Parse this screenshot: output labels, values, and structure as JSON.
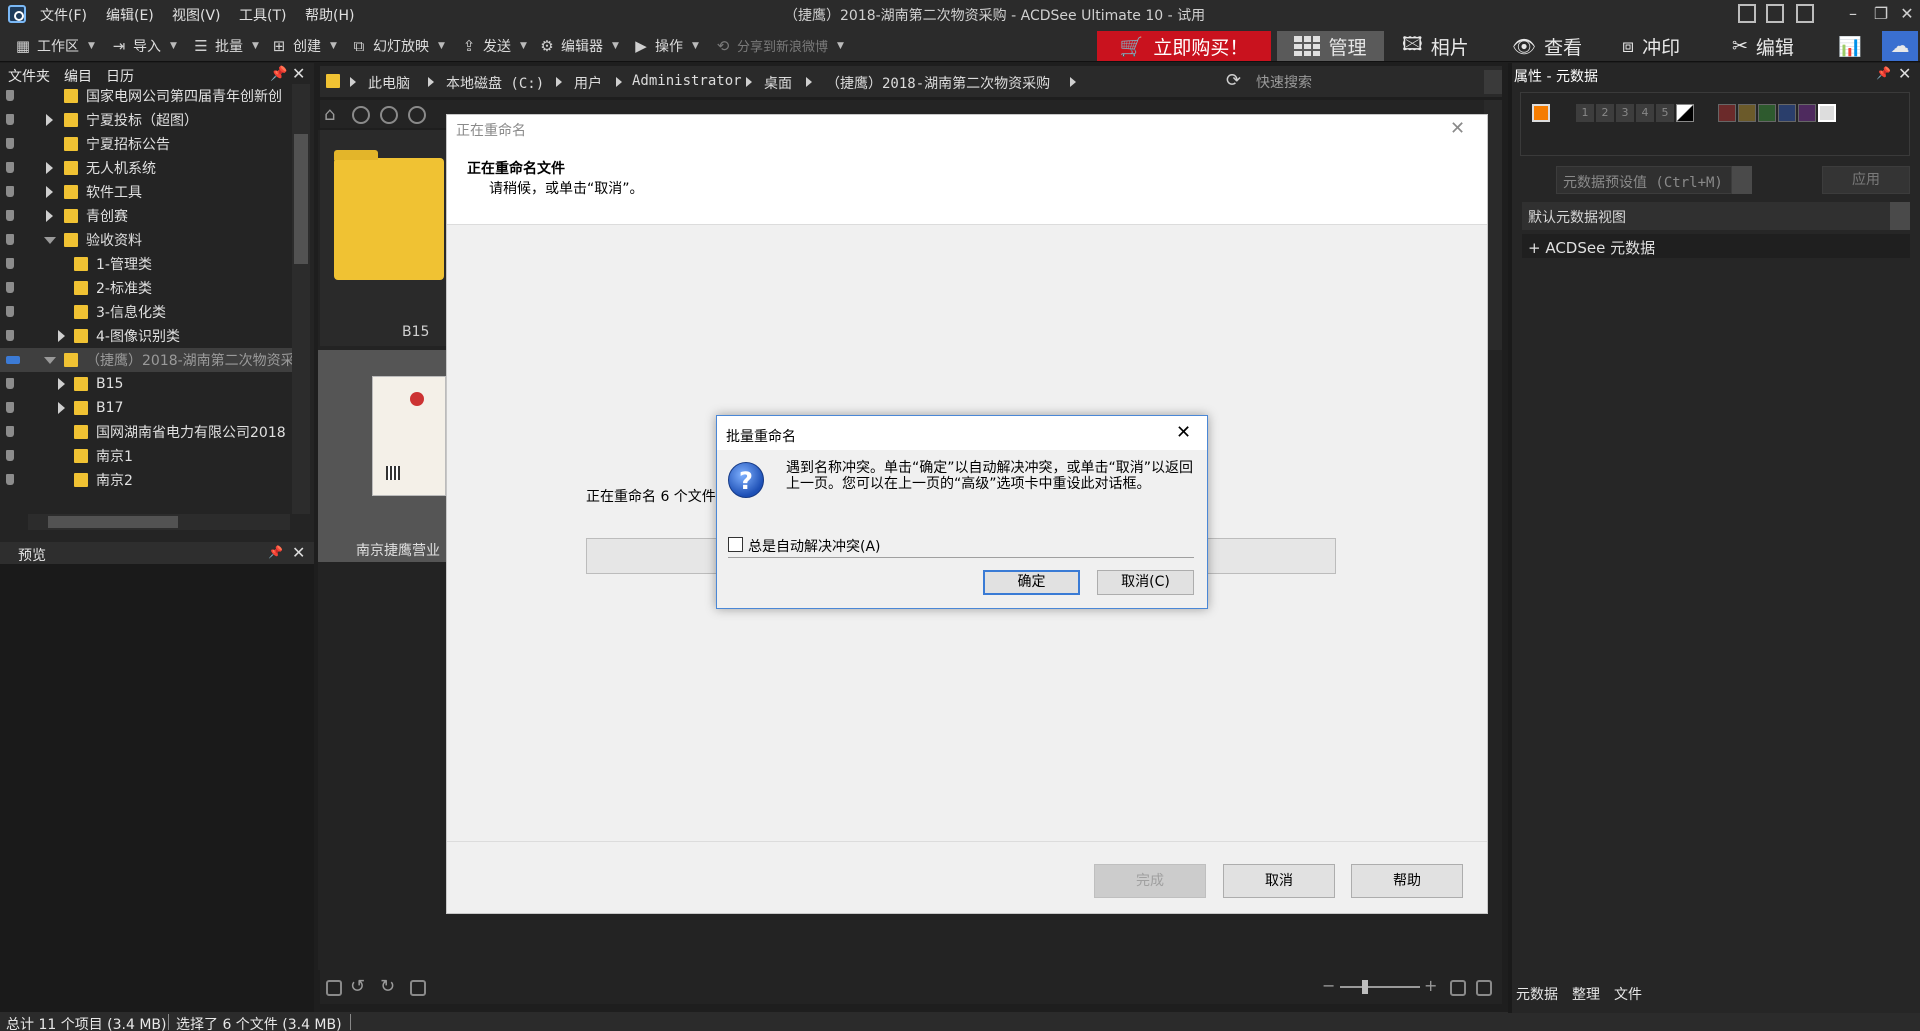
{
  "window": {
    "title": "（捷鹰）2018-湖南第二次物资采购 - ACDSee Ultimate 10 - 试用",
    "menu": [
      "文件(F)",
      "编辑(E)",
      "视图(V)",
      "工具(T)",
      "帮助(H)"
    ]
  },
  "toolbar": {
    "items": [
      "工作区",
      "导入",
      "批量",
      "创建",
      "幻灯放映",
      "发送",
      "编辑器",
      "操作",
      "分享到新浪微博"
    ],
    "buy_label": "立即购买！",
    "modes": [
      "管理",
      "相片",
      "查看",
      "冲印",
      "编辑"
    ]
  },
  "left_panel": {
    "tabs": [
      "文件夹",
      "编目",
      "日历"
    ],
    "tree": [
      {
        "label": "国家电网公司第四届青年创新创"
      },
      {
        "label": "宁夏投标（超图）"
      },
      {
        "label": "宁夏招标公告"
      },
      {
        "label": "无人机系统"
      },
      {
        "label": "软件工具"
      },
      {
        "label": "青创赛"
      },
      {
        "label": "验收资料"
      },
      {
        "label": "1-管理类"
      },
      {
        "label": "2-标准类"
      },
      {
        "label": "3-信息化类"
      },
      {
        "label": "4-图像识别类"
      },
      {
        "label": "（捷鹰）2018-湖南第二次物资采"
      },
      {
        "label": "B15"
      },
      {
        "label": "B17"
      },
      {
        "label": "国网湖南省电力有限公司2018"
      },
      {
        "label": "南京1"
      },
      {
        "label": "南京2"
      }
    ],
    "preview_label": "预览"
  },
  "address_bar": {
    "crumbs": [
      "此电脑",
      "本地磁盘 (C:)",
      "用户",
      "Administrator",
      "桌面",
      "（捷鹰）2018-湖南第二次物资采购"
    ],
    "search_placeholder": "快速搜索"
  },
  "browser": {
    "thumb_folder_label": "B15",
    "thumb_doc_label": "南京捷鹰营业"
  },
  "status": {
    "total": "总计 11 个项目 (3.4 MB)",
    "selected": "选择了 6 个文件 (3.4 MB)"
  },
  "right_panel": {
    "header": "属性 - 元数据",
    "ratings": [
      "1",
      "2",
      "3",
      "4",
      "5"
    ],
    "preset_placeholder": "元数据预设值 (Ctrl+M)",
    "apply_label": "应用",
    "view_label": "默认元数据视图",
    "acdsee_meta_label": "+ ACDSee 元数据",
    "bottom_tabs": [
      "元数据",
      "整理",
      "文件"
    ]
  },
  "rename_dialog": {
    "title": "正在重命名",
    "heading": "正在重命名文件",
    "subtext": "请稍候，或单击“取消”。",
    "progress_text": "正在重命名 6 个文件",
    "finish_label": "完成",
    "cancel_label": "取消",
    "help_label": "帮助"
  },
  "conflict_dialog": {
    "title": "批量重命名",
    "message": "遇到名称冲突。单击“确定”以自动解决冲突，或单击“取消”以返回上一页。您可以在上一页的“高级”选项卡中重设此对话框。",
    "checkbox_label": "总是自动解决冲突(A)",
    "ok_label": "确定",
    "cancel_label": "取消(C)"
  },
  "colors": {
    "accent_red": "#c9121e",
    "label_orange": "#f57c00",
    "folder_yellow": "#f0c233"
  }
}
